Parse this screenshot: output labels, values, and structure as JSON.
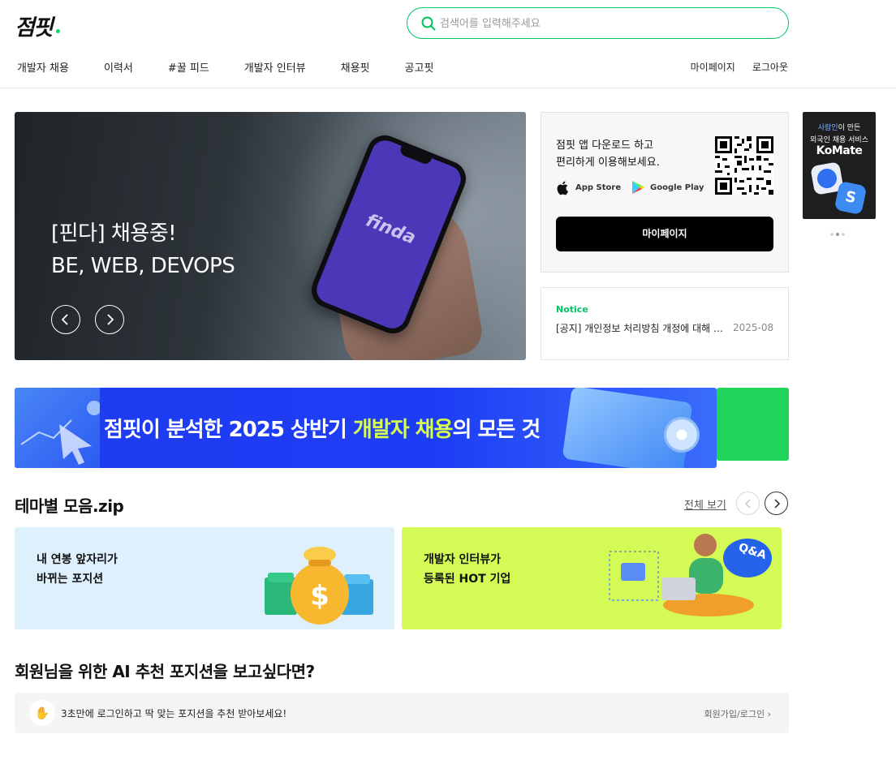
{
  "header": {
    "logo": "점핏",
    "search_placeholder": "검색어를 입력해주세요",
    "nav": [
      "개발자 채용",
      "이력서",
      "#꿀 피드",
      "개발자 인터뷰",
      "채용핏",
      "공고핏"
    ],
    "util": [
      "마이페이지",
      "로그아웃"
    ]
  },
  "hero": {
    "title_line1": "[핀다] 채용중!",
    "title_line2": "BE, WEB, DEVOPS",
    "phone_brand": "finda"
  },
  "app_box": {
    "text_line1": "점핏 앱 다운로드 하고",
    "text_line2": "편리하게 이용해보세요.",
    "app_store": "App Store",
    "google_play": "Google Play",
    "mypage_button": "마이페이지"
  },
  "notice": {
    "label": "Notice",
    "text": "[공지] 개인정보 처리방침 개정에 대해 안내드립니다",
    "date": "2025-08"
  },
  "side_ad": {
    "line1_highlight": "사람인",
    "line1_rest": "이 만든",
    "line2": "외국인 채용 서비스",
    "brand": "KoMate"
  },
  "banner": {
    "text_before": "점핏이 분석한 2025 상반기 ",
    "text_highlight": "개발자 채용",
    "text_after": "의 모든 것"
  },
  "theme_section": {
    "title": "테마별 모음.zip",
    "see_all": "전체 보기",
    "cards": [
      {
        "line1": "내 연봉 앞자리가",
        "line2": "바뀌는 포지션",
        "bg": "#dff0fd"
      },
      {
        "line1": "개발자 인터뷰가",
        "line2": "등록된 HOT 기업",
        "bg": "#d4fb55",
        "badge": "Q&A"
      }
    ]
  },
  "ai_section": {
    "title": "회원님을 위한 AI 추천 포지션을 보고싶다면?",
    "text": "3초만에 로그인하고 딱 맞는 포지션을 추천 받아보세요!",
    "link": "회원가입/로그인"
  },
  "colors": {
    "accent": "#00c362",
    "banner_blue": "#1f3cf0",
    "banner_highlight": "#d8ff4e"
  }
}
